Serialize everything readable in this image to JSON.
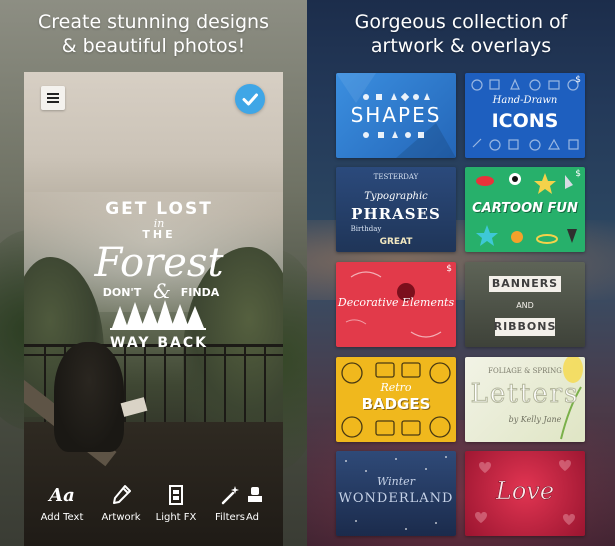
{
  "left_panel": {
    "headline_line1": "Create stunning designs",
    "headline_line2": "& beautiful photos!",
    "poster": {
      "line1": "GET LOST",
      "line2": "in",
      "line3": "THE",
      "line4": "Forest",
      "line5": "DON'T",
      "line6": "&",
      "line7": "FINDA",
      "line8": "WAY BACK"
    },
    "toolbar": [
      {
        "label": "Add Text",
        "icon": "text-aa-icon"
      },
      {
        "label": "Artwork",
        "icon": "brush-icon"
      },
      {
        "label": "Light FX",
        "icon": "film-strip-icon"
      },
      {
        "label": "Filters",
        "icon": "magic-wand-icon"
      },
      {
        "label": "Ad",
        "icon": "stamp-icon"
      }
    ],
    "glyphs": {
      "aa": "Aa"
    }
  },
  "right_panel": {
    "headline_line1": "Gorgeous collection of",
    "headline_line2": "artwork & overlays",
    "cards": [
      {
        "title": "SHAPES",
        "color": "#2f7fd0"
      },
      {
        "title_top": "Hand-Drawn",
        "title": "ICONS",
        "tag": "$",
        "color": "#1e5fbf"
      },
      {
        "title_top": "Typographic",
        "title": "PHRASES",
        "words": [
          "TESTERDAY",
          "Birthday",
          "GREAT"
        ],
        "color": "#263f6a"
      },
      {
        "title": "CARTOON FUN",
        "tag": "$",
        "color": "#27b06b"
      },
      {
        "title": "Decorative Elements",
        "tag": "$",
        "color": "#e23a4a"
      },
      {
        "title_top": "BANNERS",
        "title_mid": "AND",
        "title": "RIBBONS",
        "color": "#4a4f45"
      },
      {
        "title_top": "Retro",
        "title": "BADGES",
        "color": "#f0b81d"
      },
      {
        "title_top": "FOLIAGE & SPRING",
        "title": "Letters",
        "title_sub": "by Kelly Jane",
        "color": "#e9ecd8"
      },
      {
        "title_top": "Winter",
        "title": "WONDERLAND",
        "color": "#253a63"
      },
      {
        "title": "Love",
        "color": "#c0213f"
      }
    ]
  }
}
